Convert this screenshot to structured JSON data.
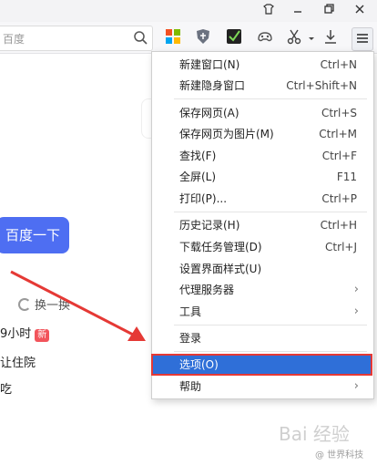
{
  "search": {
    "placeholder": "百度"
  },
  "window": {
    "buttons": [
      "skin",
      "minimize",
      "restore",
      "close"
    ]
  },
  "page": {
    "baidu_button": "百度一下",
    "refresh_label": "换一换",
    "hot_items": [
      {
        "text": "9小时",
        "badge": "新"
      },
      {
        "text": "让住院"
      },
      {
        "text": "吃"
      }
    ]
  },
  "menu": {
    "items": [
      {
        "label": "新建窗口(N)",
        "shortcut": "Ctrl+N"
      },
      {
        "label": "新建隐身窗口",
        "shortcut": "Ctrl+Shift+N"
      },
      {
        "label": "保存网页(A)",
        "shortcut": "Ctrl+S"
      },
      {
        "label": "保存网页为图片(M)",
        "shortcut": "Ctrl+M"
      },
      {
        "label": "查找(F)",
        "shortcut": "Ctrl+F"
      },
      {
        "label": "全屏(L)",
        "shortcut": "F11"
      },
      {
        "label": "打印(P)...",
        "shortcut": "Ctrl+P"
      },
      {
        "label": "历史记录(H)",
        "shortcut": "Ctrl+H"
      },
      {
        "label": "下载任务管理(D)",
        "shortcut": "Ctrl+J"
      },
      {
        "label": "设置界面样式(U)",
        "shortcut": ""
      },
      {
        "label": "代理服务器",
        "shortcut": "",
        "submenu": true
      },
      {
        "label": "工具",
        "shortcut": "",
        "submenu": true
      },
      {
        "label": "登录",
        "shortcut": ""
      },
      {
        "label": "选项(O)",
        "shortcut": "",
        "selected": true
      },
      {
        "label": "帮助",
        "shortcut": "",
        "submenu": true
      }
    ],
    "submenu_glyph": "›"
  },
  "watermark": {
    "main": "Bai 经验",
    "sub": "@ 世界科技"
  },
  "colors": {
    "accent": "#2f6fd8",
    "highlight_border": "#e53935",
    "baidu_blue": "#4e6ef2",
    "arrow": "#e53935"
  }
}
